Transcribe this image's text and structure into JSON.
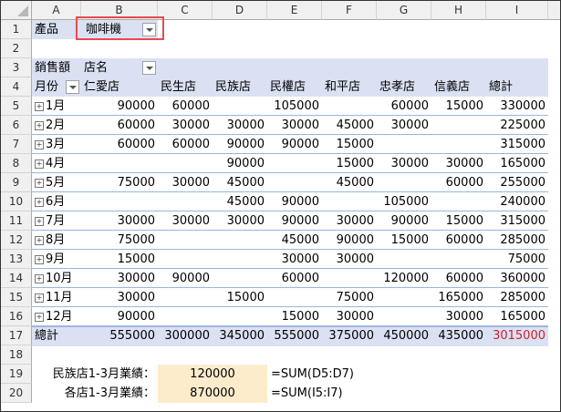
{
  "columns": [
    "A",
    "B",
    "C",
    "D",
    "E",
    "F",
    "G",
    "H",
    "I"
  ],
  "rows": [
    "1",
    "2",
    "3",
    "4",
    "5",
    "6",
    "7",
    "8",
    "9",
    "10",
    "11",
    "12",
    "13",
    "14",
    "15",
    "16",
    "17",
    "18",
    "19",
    "20"
  ],
  "filter": {
    "label": "產品",
    "value": "咖啡機"
  },
  "pivot": {
    "value_label": "銷售額",
    "column_field": "店名",
    "row_field": "月份",
    "stores": [
      "仁愛店",
      "民生店",
      "民族店",
      "民權店",
      "和平店",
      "忠孝店",
      "信義店",
      "總計"
    ],
    "data": [
      {
        "month": "1月",
        "v": [
          "90000",
          "60000",
          "",
          "105000",
          "",
          "60000",
          "15000",
          "330000"
        ]
      },
      {
        "month": "2月",
        "v": [
          "60000",
          "30000",
          "30000",
          "30000",
          "45000",
          "30000",
          "",
          "225000"
        ]
      },
      {
        "month": "3月",
        "v": [
          "60000",
          "60000",
          "90000",
          "90000",
          "15000",
          "",
          "",
          "315000"
        ]
      },
      {
        "month": "4月",
        "v": [
          "",
          "",
          "90000",
          "",
          "15000",
          "30000",
          "30000",
          "165000"
        ]
      },
      {
        "month": "5月",
        "v": [
          "75000",
          "30000",
          "45000",
          "",
          "45000",
          "",
          "60000",
          "255000"
        ]
      },
      {
        "month": "6月",
        "v": [
          "",
          "",
          "45000",
          "90000",
          "",
          "105000",
          "",
          "240000"
        ]
      },
      {
        "month": "7月",
        "v": [
          "30000",
          "30000",
          "30000",
          "90000",
          "30000",
          "90000",
          "15000",
          "315000"
        ]
      },
      {
        "month": "8月",
        "v": [
          "75000",
          "",
          "",
          "45000",
          "90000",
          "15000",
          "60000",
          "285000"
        ]
      },
      {
        "month": "9月",
        "v": [
          "15000",
          "",
          "",
          "30000",
          "30000",
          "",
          "",
          "75000"
        ]
      },
      {
        "month": "10月",
        "v": [
          "30000",
          "90000",
          "",
          "60000",
          "",
          "120000",
          "60000",
          "360000"
        ]
      },
      {
        "month": "11月",
        "v": [
          "30000",
          "",
          "15000",
          "",
          "75000",
          "",
          "165000",
          "285000"
        ]
      },
      {
        "month": "12月",
        "v": [
          "90000",
          "",
          "",
          "15000",
          "30000",
          "",
          "30000",
          "165000"
        ]
      }
    ],
    "total_label": "總計",
    "totals": [
      "555000",
      "300000",
      "345000",
      "555000",
      "375000",
      "450000",
      "435000",
      "3015000"
    ],
    "grand_total_color": "#d0202e"
  },
  "calc": [
    {
      "label": "民族店1-3月業績：",
      "value": "120000",
      "formula": "=SUM(D5:D7)"
    },
    {
      "label": "各店1-3月業績：",
      "value": "870000",
      "formula": "=SUM(I5:I7)"
    }
  ]
}
